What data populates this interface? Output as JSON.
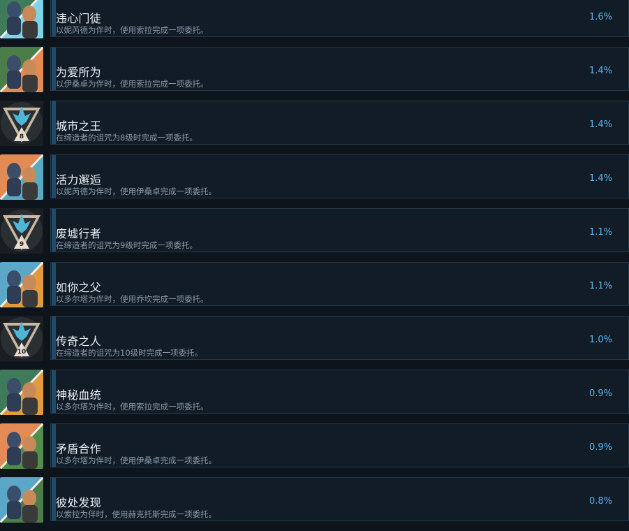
{
  "achievements": [
    {
      "title": "违心门徒",
      "desc": "以妮芮德为伴时，使用索拉完成一项委托。",
      "pct": "1.6%",
      "icon": "dual-portrait",
      "colors": [
        "#3f7a5a",
        "#7fd4e8"
      ]
    },
    {
      "title": "为爱所为",
      "desc": "以伊桑卓为伴时，使用索拉完成一项委托。",
      "pct": "1.4%",
      "icon": "dual-portrait",
      "colors": [
        "#4b7d49",
        "#e48a55"
      ]
    },
    {
      "title": "城市之王",
      "desc": "在缔造者的诅咒为8级时完成一项委托。",
      "pct": "1.4%",
      "icon": "curse-level-badge",
      "level": "8"
    },
    {
      "title": "活力邂逅",
      "desc": "以妮芮德为伴时，使用伊桑卓完成一项委托。",
      "pct": "1.4%",
      "icon": "dual-portrait",
      "colors": [
        "#e38a55",
        "#5ba8c4"
      ]
    },
    {
      "title": "废墟行者",
      "desc": "在缔造者的诅咒为9级时完成一项委托。",
      "pct": "1.1%",
      "icon": "curse-level-badge",
      "level": "9"
    },
    {
      "title": "如你之父",
      "desc": "以多尔塔为伴时，使用乔坎完成一项委托。",
      "pct": "1.1%",
      "icon": "dual-portrait",
      "colors": [
        "#5aa7c8",
        "#e19b3e"
      ]
    },
    {
      "title": "传奇之人",
      "desc": "在缔造者的诅咒为10级时完成一项委托。",
      "pct": "1.0%",
      "icon": "curse-level-badge",
      "level": "10"
    },
    {
      "title": "神秘血统",
      "desc": "以多尔塔为伴时，使用索拉完成一项委托。",
      "pct": "0.9%",
      "icon": "dual-portrait",
      "colors": [
        "#3f7a5a",
        "#e19b3e"
      ]
    },
    {
      "title": "矛盾合作",
      "desc": "以多尔塔为伴时，使用伊桑卓完成一项委托。",
      "pct": "0.9%",
      "icon": "dual-portrait",
      "colors": [
        "#e38a55",
        "#4f8f4a"
      ]
    },
    {
      "title": "彼处发现",
      "desc": "以索拉为伴时，使用赫克托斯完成一项委托。",
      "pct": "0.8%",
      "icon": "dual-portrait",
      "colors": [
        "#5aa7c8",
        "#4b7d49"
      ]
    }
  ]
}
